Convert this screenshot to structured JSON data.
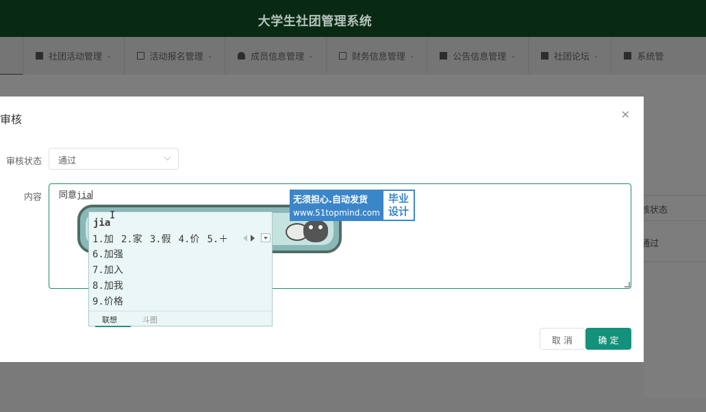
{
  "app": {
    "title": "大学生社团管理系统"
  },
  "nav": {
    "items": [
      {
        "label": "社团活动管理",
        "icon": "book-icon"
      },
      {
        "label": "活动报名管理",
        "icon": "card-icon"
      },
      {
        "label": "成员信息管理",
        "icon": "person-icon"
      },
      {
        "label": "财务信息管理",
        "icon": "crop-icon"
      },
      {
        "label": "公告信息管理",
        "icon": "announce-icon"
      },
      {
        "label": "社团论坛",
        "icon": "monitor-icon"
      },
      {
        "label": "系统管",
        "icon": "settings-icon"
      }
    ]
  },
  "background_table": {
    "header": "核状态",
    "cell": "通过"
  },
  "dialog": {
    "title": "审核",
    "status_label": "审核状态",
    "status_value": "通过",
    "content_label": "内容",
    "content_text": "同意",
    "composing_text": "jia",
    "cancel_label": "取 消",
    "confirm_label": "确 定"
  },
  "ime": {
    "pinyin": "jia",
    "row1": [
      "1.加",
      "2.家",
      "3.假",
      "4.价",
      "5.＋"
    ],
    "candidates": [
      "6.加强",
      "7.加入",
      "8.加我",
      "9.价格"
    ],
    "tab_active": "联想",
    "tab_other": "斗图"
  },
  "ad": {
    "line1": "无须担心.自动发货",
    "line2": "www.51topmind.com",
    "badge_line1": "毕业",
    "badge_line2": "设计"
  },
  "colors": {
    "primary": "#14917a",
    "header_bg": "#082a14",
    "ad_blue": "#3b86c9"
  }
}
